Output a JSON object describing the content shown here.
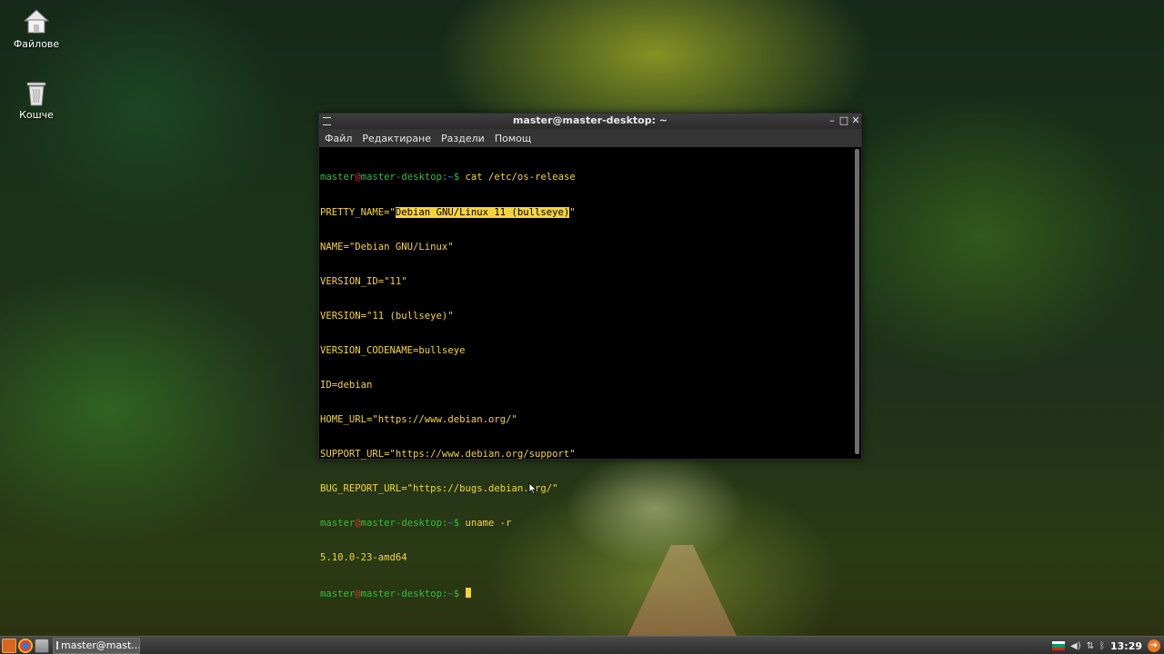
{
  "desktop": {
    "icons": [
      {
        "label": "Файлове",
        "icon": "home-folder-icon"
      },
      {
        "label": "Кошче",
        "icon": "trash-icon"
      }
    ]
  },
  "terminal": {
    "title": "master@master-desktop: ~",
    "menu": [
      "Файл",
      "Редактиране",
      "Раздели",
      "Помощ"
    ],
    "prompt": {
      "user": "master",
      "at": "@",
      "host": "master-desktop",
      "colon": ":",
      "path": "~",
      "dollar": "$"
    },
    "commands": [
      "cat /etc/os-release",
      "uname -r"
    ],
    "output": {
      "pretty_prefix": "PRETTY_NAME=\"",
      "pretty_value": "Debian GNU/Linux 11 (bullseye)",
      "pretty_suffix": "\"",
      "lines": [
        "NAME=\"Debian GNU/Linux\"",
        "VERSION_ID=\"11\"",
        "VERSION=\"11 (bullseye)\"",
        "VERSION_CODENAME=bullseye",
        "ID=debian",
        "HOME_URL=\"https://www.debian.org/\"",
        "SUPPORT_URL=\"https://www.debian.org/support\"",
        "BUG_REPORT_URL=\"https://bugs.debian.org/\""
      ],
      "uname": "5.10.0-23-amd64"
    },
    "colors": {
      "text": "#f5d43a",
      "prompt_user": "#2fbf3e",
      "prompt_at": "#cf3b2f",
      "prompt_path": "#3a6fd8"
    }
  },
  "taskbar": {
    "launchers": [
      "menu-icon",
      "browser-icon",
      "file-manager-icon"
    ],
    "task_label": "master@mast...",
    "clock": "13:29",
    "tray_icons": [
      "bulgarian-flag-icon",
      "volume-icon",
      "network-icon",
      "bluetooth-icon",
      "power-icon"
    ]
  }
}
